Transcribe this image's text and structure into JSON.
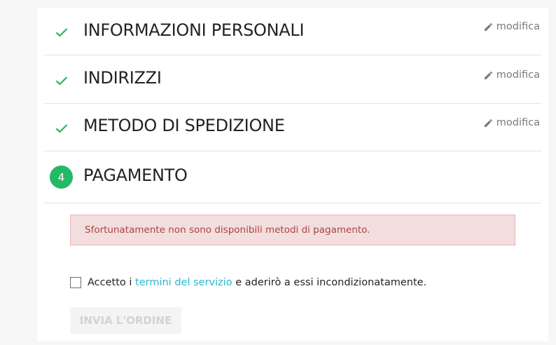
{
  "steps": [
    {
      "title": "INFORMAZIONI PERSONALI",
      "edit_label": "modifica"
    },
    {
      "title": "INDIRIZZI",
      "edit_label": "modifica"
    },
    {
      "title": "METODO DI SPEDIZIONE",
      "edit_label": "modifica"
    }
  ],
  "current_step": {
    "number": "4",
    "title": "PAGAMENTO"
  },
  "alert": {
    "message": "Sfortunatamente non sono disponibili metodi di pagamento."
  },
  "terms": {
    "prefix": "Accetto i ",
    "link": "termini del servizio",
    "suffix": " e aderirò a essi incondizionatamente."
  },
  "order_button": {
    "label": "INVIA L'ORDINE"
  },
  "colors": {
    "accent_green": "#24b966",
    "link": "#2fb5d2",
    "alert_text": "#a94442"
  },
  "icons": {
    "done": "check-icon",
    "edit": "pencil-icon"
  }
}
